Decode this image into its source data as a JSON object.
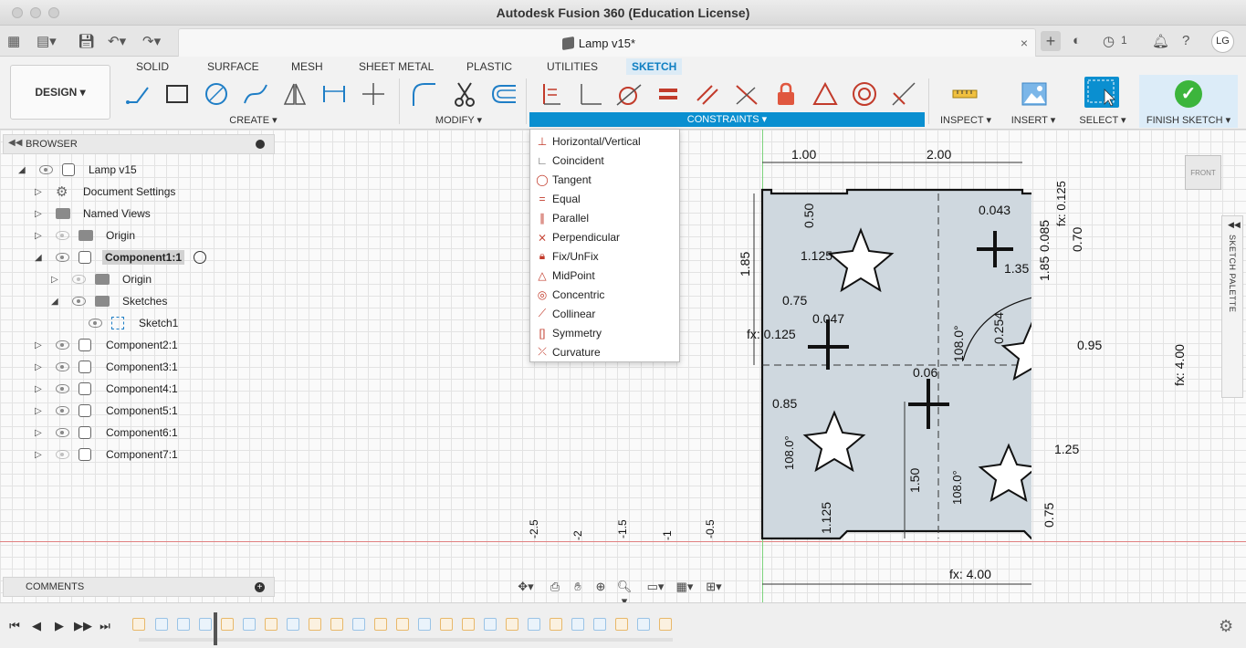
{
  "window": {
    "title": "Autodesk Fusion 360 (Education License)"
  },
  "doc_tab": {
    "title": "Lamp v15*",
    "close_icon": "×"
  },
  "topbar": {
    "jobs_count": "1",
    "user_initials": "LG"
  },
  "workspace": {
    "label": "DESIGN ▾"
  },
  "ws_tabs": [
    "SOLID",
    "SURFACE",
    "MESH",
    "SHEET METAL",
    "PLASTIC",
    "UTILITIES",
    "SKETCH"
  ],
  "groups": {
    "create": "CREATE ▾",
    "modify": "MODIFY ▾",
    "constraints": "CONSTRAINTS ▾",
    "inspect": "INSPECT ▾",
    "insert": "INSERT ▾",
    "select": "SELECT ▾",
    "finish": "FINISH SKETCH ▾"
  },
  "browser": {
    "title": "BROWSER",
    "items": [
      {
        "label": "Lamp v15"
      },
      {
        "label": "Document Settings"
      },
      {
        "label": "Named Views"
      },
      {
        "label": "Origin"
      },
      {
        "label": "Component1:1"
      },
      {
        "label": "Origin"
      },
      {
        "label": "Sketches"
      },
      {
        "label": "Sketch1"
      },
      {
        "label": "Component2:1"
      },
      {
        "label": "Component3:1"
      },
      {
        "label": "Component4:1"
      },
      {
        "label": "Component5:1"
      },
      {
        "label": "Component6:1"
      },
      {
        "label": "Component7:1"
      }
    ]
  },
  "comments": {
    "title": "COMMENTS"
  },
  "constraints_menu": [
    "Horizontal/Vertical",
    "Coincident",
    "Tangent",
    "Equal",
    "Parallel",
    "Perpendicular",
    "Fix/UnFix",
    "MidPoint",
    "Concentric",
    "Collinear",
    "Symmetry",
    "Curvature"
  ],
  "dimensions": {
    "d1": "1.00",
    "d2": "2.00",
    "d3": "fx: 4.00",
    "d4": "fx: 4.00",
    "d5": "1.85",
    "d6": "0.50",
    "d7": "1.125",
    "d8": "0.75",
    "d9": "fx: 0.125",
    "d10": "0.047",
    "d11": "0.85",
    "d12": "0.043",
    "d13": "0.085",
    "d14": "0.70",
    "d15": "1.35",
    "d16": "1.85",
    "d17": "0.95",
    "d18": "0.254",
    "d19": "108.0°",
    "d20": "0.06",
    "d21": "1.50",
    "d22": "1.125",
    "d23": "1.25",
    "d24": "0.75",
    "d25": "fx: 0.125",
    "d26": "108.0°",
    "d27": "108.0°"
  },
  "ruler": [
    "-2.5",
    "-2",
    "-1.5",
    "-1",
    "-0.5"
  ],
  "viewcube": {
    "face": "FRONT"
  },
  "sketch_palette": {
    "label": "SKETCH PALETTE"
  },
  "colors": {
    "accent": "#0a8fd0",
    "finish_check": "#3cb53c",
    "constraint_icon": "#c23b2b"
  }
}
